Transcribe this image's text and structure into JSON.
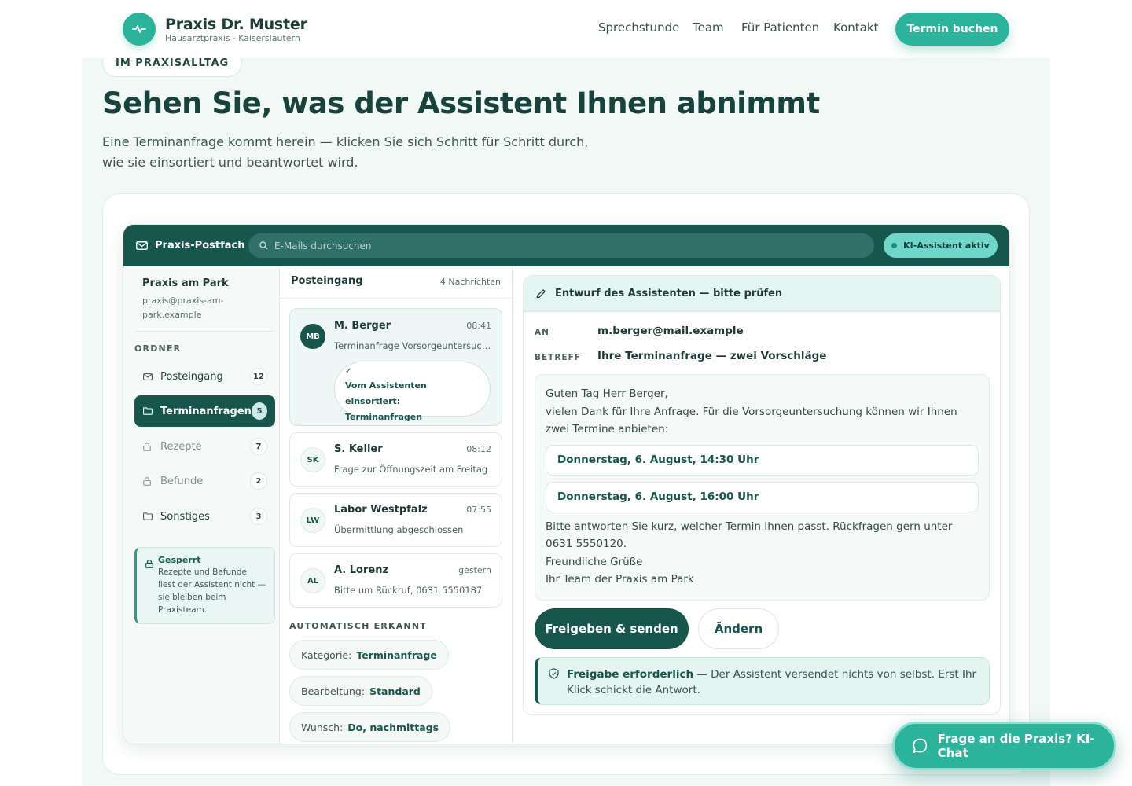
{
  "header": {
    "brand_name": "Praxis Dr. Muster",
    "brand_sub": "Hausarztpraxis · Kaiserslautern",
    "nav": [
      "Sprechstunde",
      "Team",
      "Für Patienten",
      "Kontakt"
    ],
    "cta": "Termin buchen"
  },
  "section": {
    "eyebrow": "IM PRAXISALLTAG",
    "headline": "Sehen Sie, was der Assistent Ihnen abnimmt",
    "lead": "Eine Terminanfrage kommt herein — klicken Sie sich Schritt für Schritt durch, wie sie einsortiert und beantwortet wird."
  },
  "app": {
    "title": "Praxis-Postfach",
    "search_placeholder": "E-Mails durchsuchen",
    "ai_status": "KI-Assistent aktiv",
    "account_name": "Praxis am Park",
    "account_mail": "praxis@praxis-am-park.example",
    "folders_heading": "ORDNER",
    "folders": [
      {
        "label": "Posteingang",
        "count": "12",
        "icon": "mail-icon"
      },
      {
        "label": "Terminanfragen",
        "count": "5",
        "icon": "folder-icon"
      },
      {
        "label": "Rezepte",
        "count": "7",
        "icon": "lock-icon"
      },
      {
        "label": "Befunde",
        "count": "2",
        "icon": "lock-icon"
      },
      {
        "label": "Sonstiges",
        "count": "3",
        "icon": "folder-icon"
      }
    ],
    "lock_note_title": "Gesperrt",
    "lock_note_text": "Rezepte und Befunde liest der Assistent nicht — sie bleiben beim Praxisteam.",
    "list_title": "Posteingang",
    "list_count": "4 Nachrichten",
    "messages": [
      {
        "initials": "MB",
        "sender": "M. Berger",
        "time": "08:41",
        "subject": "Terminanfrage Vorsorgeuntersuchung"
      },
      {
        "initials": "SK",
        "sender": "S. Keller",
        "time": "08:12",
        "subject": "Frage zur Öffnungszeit am Freitag"
      },
      {
        "initials": "LW",
        "sender": "Labor Westpfalz",
        "time": "07:55",
        "subject": "Übermittlung abgeschlossen"
      },
      {
        "initials": "AL",
        "sender": "A. Lorenz",
        "time": "gestern",
        "subject": "Bitte um Rückruf, 0631 5550187"
      }
    ],
    "sorted_check": "✓",
    "sorted_text": "Vom Assistenten einsortiert: Terminanfragen",
    "auto_heading": "AUTOMATISCH ERKANNT",
    "chips": [
      {
        "key": "Kategorie:",
        "value": "Terminanfrage"
      },
      {
        "key": "Bearbeitung:",
        "value": "Standard"
      },
      {
        "key": "Wunsch:",
        "value": "Do, nachmittags"
      }
    ],
    "draft": {
      "title": "Entwurf des Assistenten — bitte prüfen",
      "to_label": "AN",
      "to": "m.berger@mail.example",
      "subject_label": "BETREFF",
      "subject": "Ihre Terminanfrage — zwei Vorschläge",
      "greeting": "Guten Tag Herr Berger,",
      "intro": "vielen Dank für Ihre Anfrage. Für die Vorsorgeuntersuchung können wir Ihnen zwei Termine anbieten:",
      "slots": [
        "Donnerstag, 6. August, 14:30 Uhr",
        "Donnerstag, 6. August, 16:00 Uhr"
      ],
      "outro": "Bitte antworten Sie kurz, welcher Termin Ihnen passt. Rückfragen gern unter 0631 5550120.",
      "closing": "Freundliche Grüße",
      "signature": "Ihr Team der Praxis am Park",
      "send": "Freigeben & senden",
      "edit": "Ändern",
      "approval_bold": "Freigabe erforderlich",
      "approval_text": "— Der Assistent versendet nichts von selbst. Erst Ihr Klick schickt die Antwort."
    }
  },
  "chat": {
    "label": "Frage an die Praxis? KI-Chat"
  },
  "colors": {
    "primary": "#16564d",
    "accent": "#2bb39b",
    "background": "#f1f8f6"
  }
}
